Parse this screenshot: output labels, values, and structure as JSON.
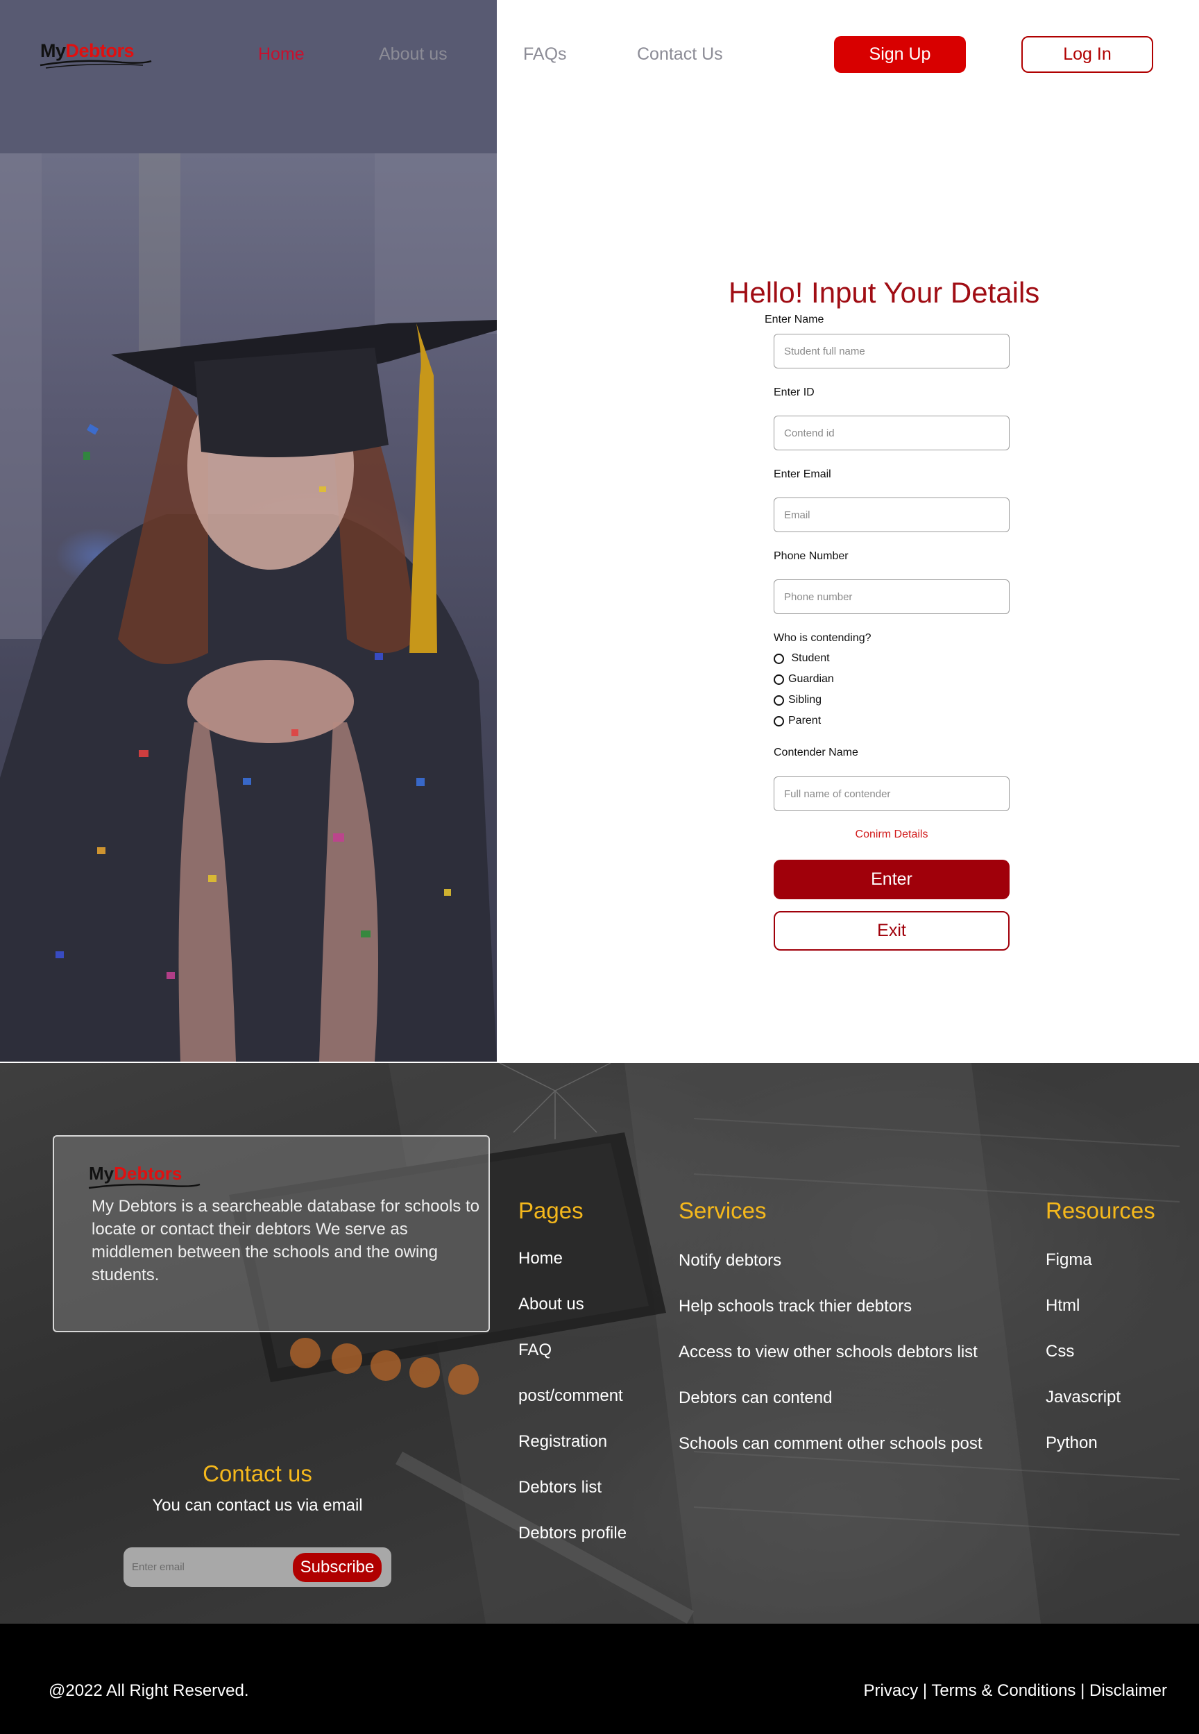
{
  "brand": {
    "logo_my": "My",
    "logo_debtors": "Debtors",
    "accent": "#d80000",
    "dark_red": "#a0000a",
    "gold": "#f5b81c"
  },
  "nav": {
    "items": [
      {
        "label": "Home",
        "active": true
      },
      {
        "label": "About us",
        "active": false
      },
      {
        "label": "FAQs",
        "active": false
      },
      {
        "label": "Contact Us",
        "active": false
      }
    ],
    "signup": "Sign Up",
    "login": "Log In"
  },
  "form": {
    "title": "Hello! Input Your Details",
    "name_label": "Enter Name",
    "name_placeholder": "Student full name",
    "id_label": "Enter ID",
    "id_placeholder": "Contend id",
    "email_label": "Enter Email",
    "email_placeholder": "Email",
    "phone_label": "Phone Number",
    "phone_placeholder": "Phone number",
    "contending_label": "Who is contending?",
    "contending_options": [
      " Student",
      "Guardian",
      "Sibling",
      "Parent"
    ],
    "contender_label": "Contender Name",
    "contender_placeholder": "Full name of contender",
    "confirm_link": "Conirm Details",
    "enter_button": "Enter",
    "exit_button": "Exit"
  },
  "footer": {
    "about_text": "My Debtors is a searcheable database for schools to locate or contact their debtors We serve as middlemen between the schools and the owing students.",
    "pages_heading": "Pages",
    "pages": [
      "Home",
      "About us",
      "FAQ",
      "post/comment",
      "Registration",
      "Debtors list",
      "Debtors profile"
    ],
    "services_heading": "Services",
    "services": [
      "Notify debtors",
      "Help schools track thier debtors",
      "Access to view other schools debtors list",
      "Debtors can contend",
      "Schools can comment other schools post"
    ],
    "resources_heading": "Resources",
    "resources": [
      "Figma",
      "Html",
      "Css",
      "Javascript",
      "Python"
    ],
    "contact_heading": "Contact us",
    "contact_sub": "You can contact us via email",
    "email_placeholder": "Enter email",
    "subscribe_button": "Subscribe"
  },
  "bottom": {
    "copyright": "@2022 All Right Reserved.",
    "legal": "Privacy | Terms & Conditions | Disclaimer"
  }
}
